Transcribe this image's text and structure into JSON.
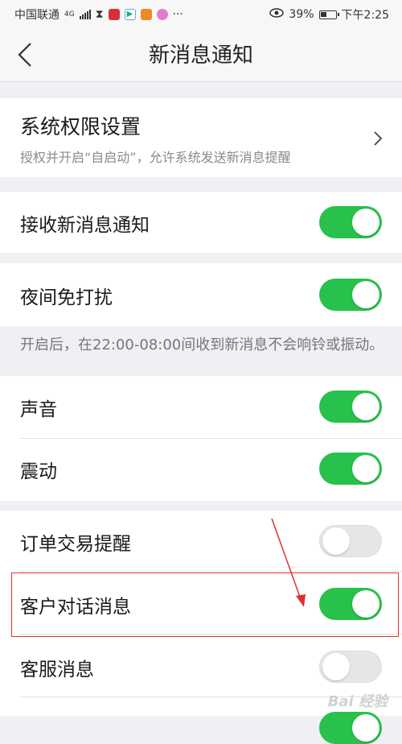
{
  "status_bar": {
    "carrier": "中国联通",
    "network": "4G",
    "more": "···",
    "battery_percent": "39%",
    "time": "下午2:25"
  },
  "nav": {
    "title": "新消息通知",
    "back_icon": "chevron-left-icon"
  },
  "permissions": {
    "title": "系统权限设置",
    "subtitle": "授权并开启“自启动”，允许系统发送新消息提醒",
    "chevron_icon": "chevron-right-icon"
  },
  "receive": {
    "label": "接收新消息通知",
    "on": true
  },
  "night_dnd": {
    "label": "夜间免打扰",
    "on": true,
    "note": "开启后，在22:00-08:00间收到新消息不会响铃或振动。"
  },
  "sound": {
    "label": "声音",
    "on": true
  },
  "vibrate": {
    "label": "震动",
    "on": true
  },
  "order_trade": {
    "label": "订单交易提醒",
    "on": false
  },
  "customer_chat": {
    "label": "客户对话消息",
    "on": true
  },
  "service_msg": {
    "label": "客服消息",
    "on": false
  },
  "annotation": {
    "highlight_color": "#e03030"
  },
  "colors": {
    "toggle_on": "#27c14b",
    "toggle_off": "#e6e6e6",
    "page_bg": "#efeff4"
  },
  "watermark": "Bai 经验"
}
